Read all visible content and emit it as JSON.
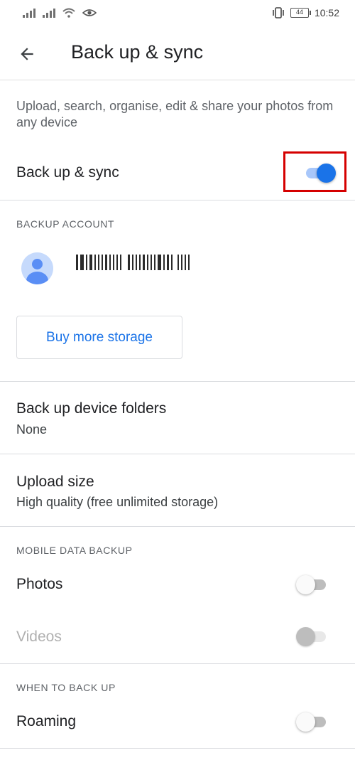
{
  "status_bar": {
    "time": "10:52",
    "battery": "44",
    "icons": [
      "signal-icon",
      "signal-icon",
      "wifi-icon",
      "eye-comfort-icon",
      "vibrate-icon",
      "battery-icon"
    ]
  },
  "app_bar": {
    "title": "Back up & sync",
    "back_icon": "arrow-back-icon"
  },
  "description": "Upload, search, organise, edit & share your photos from any device",
  "backup_sync": {
    "label": "Back up & sync",
    "enabled": true
  },
  "backup_account": {
    "header": "BACKUP ACCOUNT",
    "avatar_icon": "person-avatar-icon",
    "buy_storage_label": "Buy more storage"
  },
  "device_folders": {
    "label": "Back up device folders",
    "value": "None"
  },
  "upload_size": {
    "label": "Upload size",
    "value": "High quality (free unlimited storage)"
  },
  "mobile_data_backup": {
    "header": "MOBILE DATA BACKUP",
    "photos": {
      "label": "Photos",
      "enabled": false
    },
    "videos": {
      "label": "Videos",
      "enabled": false,
      "disabled": true
    }
  },
  "when_to_back_up": {
    "header": "WHEN TO BACK UP",
    "roaming": {
      "label": "Roaming",
      "enabled": false
    }
  },
  "colors": {
    "accent": "#1a73e8",
    "highlight": "#d50000"
  }
}
